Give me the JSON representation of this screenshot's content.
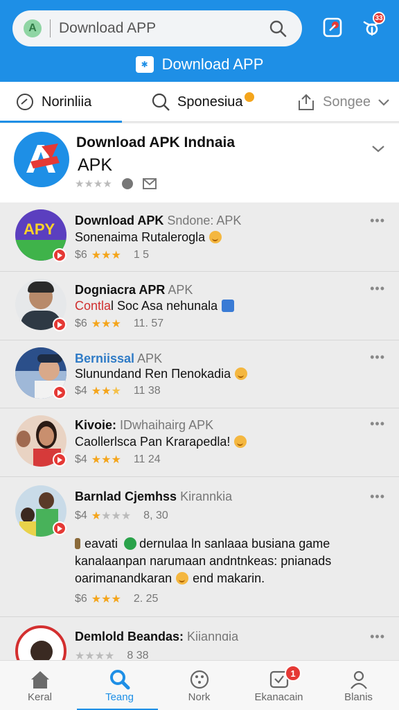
{
  "header": {
    "search_text": "Download APP",
    "banner_text": "Download APP",
    "badge_count": "33"
  },
  "tabs": [
    {
      "label": "Norinliia"
    },
    {
      "label": "Sponesiua"
    },
    {
      "label": "Songee"
    }
  ],
  "featured": {
    "title": "Download APK Indnaia",
    "subtitle": "APK"
  },
  "apps": [
    {
      "title": "Download APK",
      "title_grey": " Sndone: APK",
      "subtitle": "Sonenaima Rutalerogla",
      "price": "$6",
      "count": "1 5"
    },
    {
      "title": "Dogniacra APR",
      "title_grey": "  APK",
      "subtitle_red": "Contla",
      "subtitle": "l Soc Asa nehunala",
      "price": "$6",
      "count": "11. 57"
    },
    {
      "title_blue": "Berniissal",
      "title_grey": "  APK",
      "subtitle": "Slunundand Ren Πenokadia",
      "price": "$4",
      "count": "11 38"
    },
    {
      "title": "Kivoie:",
      "title_grey": " IDwhaihairg APK",
      "subtitle": "Caollerlsca Pan Kraraρedla!",
      "price": "$4",
      "count": "11 24"
    },
    {
      "title": "Barnlad Cjemhss",
      "title_grey": " Kirannkia",
      "price": "$4",
      "count": "8, 30",
      "desc": [
        "eavati",
        "dernulaa ln  sanlaaa busiana game",
        "kanalaanpan narumaan andntnkeas: pnianads",
        "oarimanandkaran",
        "end makarin."
      ],
      "price2": "$6",
      "count2": "2. 25"
    },
    {
      "title": "Demlold Beandas:",
      "title_grey": " Kiiannɑia",
      "price": "",
      "count": "8 38"
    }
  ],
  "nav": [
    {
      "label": "Keral"
    },
    {
      "label": "Teang"
    },
    {
      "label": "Nork"
    },
    {
      "label": "Ekanacain",
      "badge": "1"
    },
    {
      "label": "Blanis"
    }
  ],
  "colors": {
    "primary": "#1e8fe6",
    "star": "#f4a51c",
    "badge": "#e53935"
  }
}
